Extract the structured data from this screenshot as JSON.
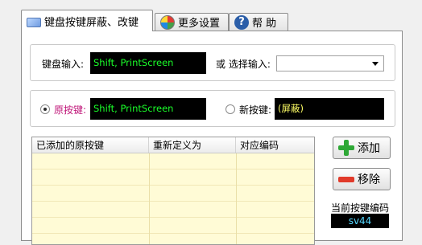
{
  "tabs": [
    {
      "label": "键盘按键屏蔽、改键",
      "icon": "keyboard-icon",
      "active": true
    },
    {
      "label": "更多设置",
      "icon": "globe-settings-icon",
      "active": false
    },
    {
      "label": "帮 助",
      "icon": "help-icon",
      "active": false
    }
  ],
  "keyboard_input": {
    "label": "键盘输入:",
    "value": "Shift, PrintScreen",
    "or_label": "或 选择输入:",
    "select_value": ""
  },
  "mapping": {
    "original_label": "原按键:",
    "original_value": "Shift, PrintScreen",
    "new_label": "新按键:",
    "new_value": "(屏蔽)"
  },
  "table": {
    "columns": [
      "已添加的原按键",
      "重新定义为",
      "对应编码"
    ],
    "rows": []
  },
  "buttons": {
    "add": "添加",
    "remove": "移除"
  },
  "current_code": {
    "label": "当前按键编码",
    "value": "sv44"
  },
  "colors": {
    "input_text": "#1aff2a",
    "mapping_text": "#ffff66",
    "code_text": "#56d7ff",
    "original_label": "#c0187a"
  }
}
